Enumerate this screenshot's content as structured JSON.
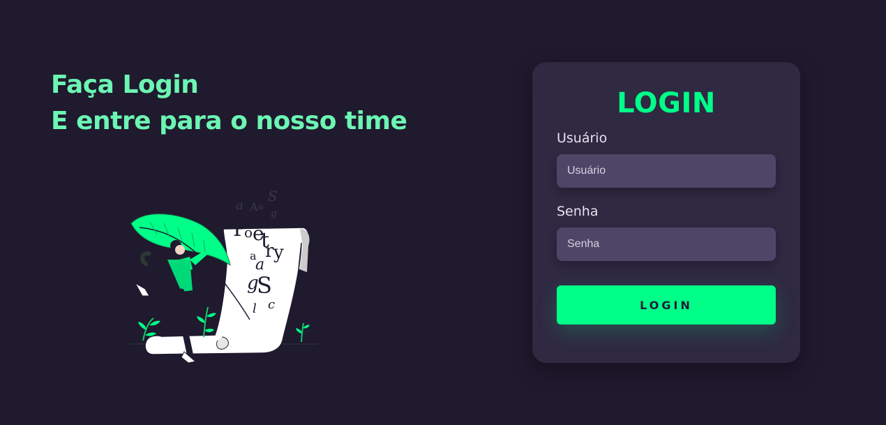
{
  "hero": {
    "line1": "Faça Login",
    "line2": "E entre para o nosso time"
  },
  "illustration": {
    "icon": "poetry-feather-illustration",
    "letters": [
      "a",
      "A",
      "a",
      "S",
      "g",
      "P",
      "o",
      "e",
      "t",
      "r",
      "y",
      "a",
      "a",
      "g",
      "S",
      "c",
      "l"
    ]
  },
  "login_card": {
    "title": "LOGIN",
    "username": {
      "label": "Usuário",
      "placeholder": "Usuário",
      "value": ""
    },
    "password": {
      "label": "Senha",
      "placeholder": "Senha",
      "value": ""
    },
    "submit_label": "LOGIN"
  },
  "colors": {
    "background": "#1f1a2e",
    "accent": "#00ff88",
    "headline": "#6cf5b3",
    "card": "#2f2942",
    "input": "#4f4566"
  }
}
